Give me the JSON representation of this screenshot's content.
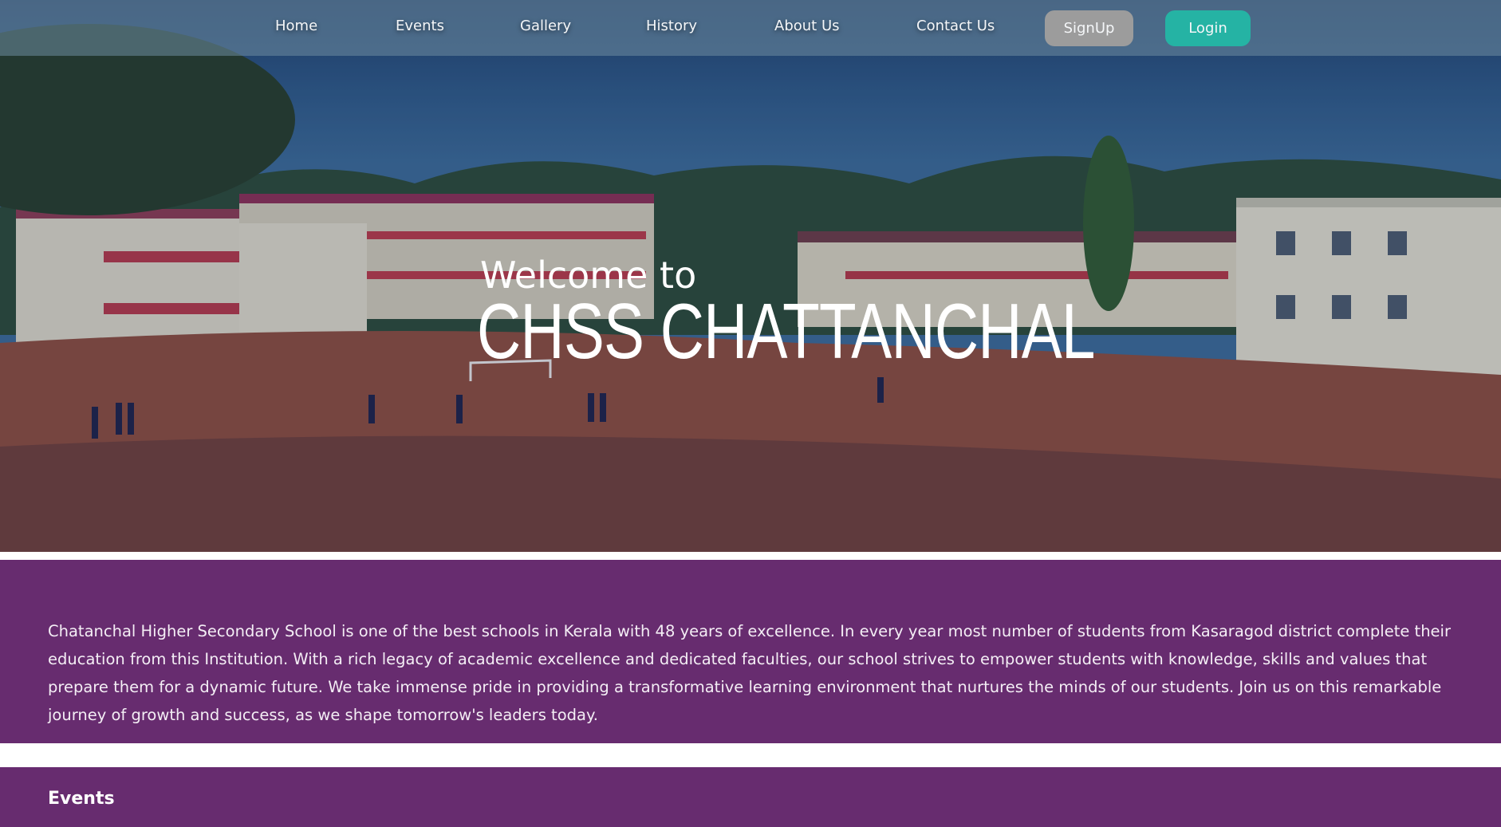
{
  "nav": {
    "links": [
      {
        "label": "Home"
      },
      {
        "label": "Events"
      },
      {
        "label": "Gallery"
      },
      {
        "label": "History"
      },
      {
        "label": "About Us"
      },
      {
        "label": "Contact Us"
      }
    ],
    "signup_label": "SignUp",
    "login_label": "Login"
  },
  "hero": {
    "welcome": "Welcome to",
    "school_name": "CHSS CHATTANCHAL"
  },
  "about": {
    "text": "Chatanchal Higher Secondary School is one of the best schools in Kerala with 48 years of excellence. In every year most number of students from Kasaragod district complete their education from this Institution. With a rich legacy of academic excellence and dedicated faculties, our school strives to empower students with knowledge, skills and values that prepare them for a dynamic future. We take immense pride in providing a transformative learning environment that nurtures the minds of our students. Join us on this remarkable journey of growth and success, as we shape tomorrow's leaders today."
  },
  "events": {
    "heading": "Events"
  },
  "colors": {
    "section_purple": "#672c6f",
    "login_teal": "#25b3a4",
    "signup_gray": "#9c9c9c",
    "nav_bar": "#6e8ca0"
  },
  "icons": {
    "hero_background": "school-campus-photo"
  }
}
